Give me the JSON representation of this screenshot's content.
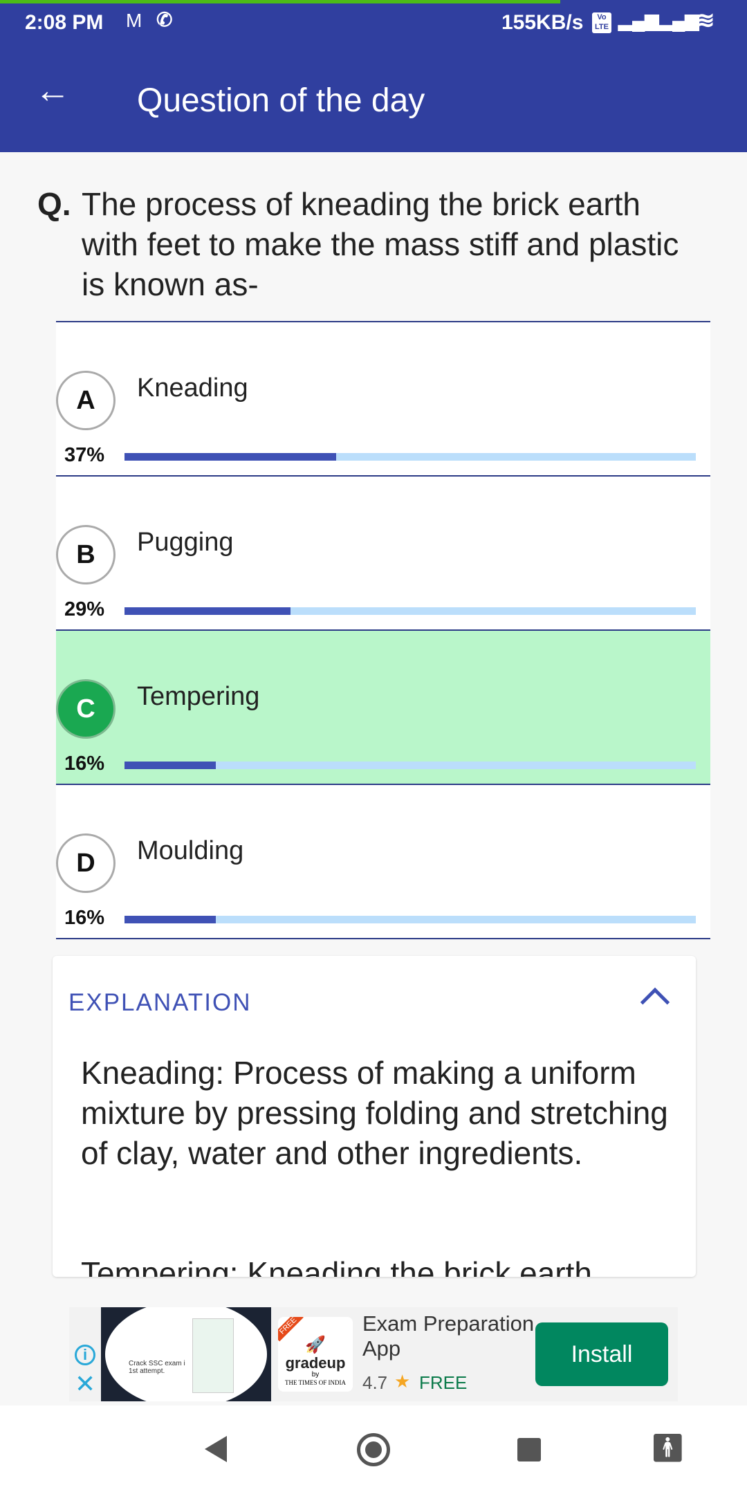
{
  "status": {
    "time": "2:08 PM",
    "speed": "155KB/s",
    "volte": "Vo LTE"
  },
  "appbar": {
    "title": "Question of the day"
  },
  "question": {
    "prefix": "Q.",
    "text": "The process of kneading the brick earth with feet to make the mass stiff and plastic is known as-"
  },
  "options": [
    {
      "letter": "A",
      "label": "Kneading",
      "percent": 37,
      "percent_label": "37%",
      "correct": false
    },
    {
      "letter": "B",
      "label": "Pugging",
      "percent": 29,
      "percent_label": "29%",
      "correct": false
    },
    {
      "letter": "C",
      "label": "Tempering",
      "percent": 16,
      "percent_label": "16%",
      "correct": true
    },
    {
      "letter": "D",
      "label": "Moulding",
      "percent": 16,
      "percent_label": "16%",
      "correct": false
    }
  ],
  "explanation": {
    "heading": "EXPLANATION",
    "body": "Kneading: Process of making a uniform mixture by pressing folding and stretching of clay, water and other ingredients.",
    "body2": "Tempering: Kneading the brick earth"
  },
  "ad": {
    "image_text": "Crack SSC exam i 1st attempt.",
    "brand": "gradeup",
    "brand_by": "by",
    "brand_sub": "THE TIMES OF INDIA",
    "badge": "FREE",
    "title": "Exam Preparation App",
    "rating": "4.7",
    "price": "FREE",
    "install": "Install"
  },
  "colors": {
    "primary": "#303f9f",
    "correct": "#b9f6ca",
    "correct_circle": "#1aa851",
    "install": "#01875f"
  }
}
